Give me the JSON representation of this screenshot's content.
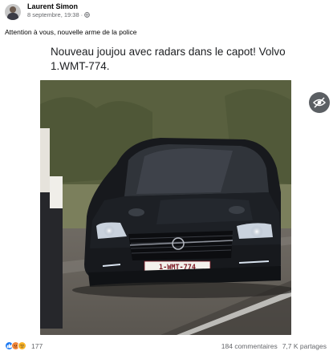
{
  "post": {
    "author": "Laurent Simon",
    "timestamp": "8 septembre, 19:38",
    "separator": "·",
    "privacy_icon": "globe-icon",
    "caption": "Attention à vous, nouvelle arme de la police"
  },
  "media": {
    "text": "Nouveau joujou avec radars dans le capot! Volvo 1.WMT-774.",
    "plate": "1-WMT-774",
    "eye_icon": "eye-icon"
  },
  "footer": {
    "reaction_icons": [
      "like-icon",
      "angry-icon",
      "sad-icon"
    ],
    "reaction_count": "177",
    "comments": "184 commentaires",
    "shares": "7,7 K partages"
  },
  "colors": {
    "secondary_text": "#65676b",
    "like_blue": "#1877f2",
    "angry_orange": "#f0843a",
    "sad_yellow": "#f7b125",
    "eye_button_bg": "#5b5f63"
  }
}
